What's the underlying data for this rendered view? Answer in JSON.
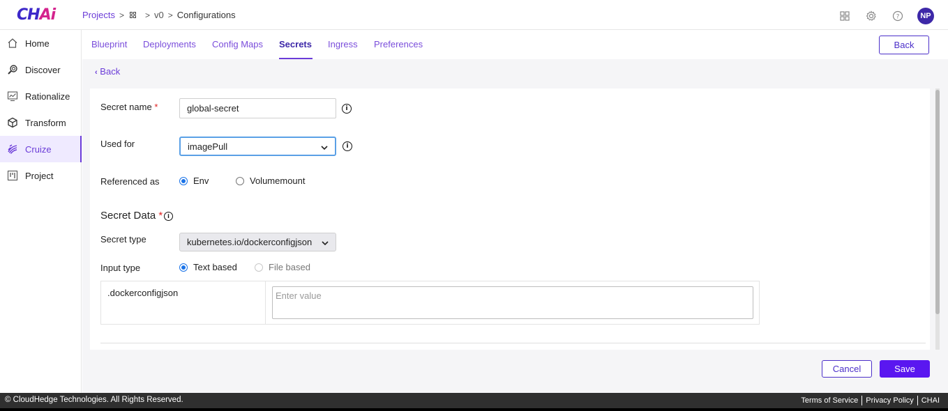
{
  "app": {
    "logo_main": "CH",
    "logo_accent": "Ai"
  },
  "breadcrumb": {
    "projects": "Projects",
    "sep": ">",
    "version": "v0",
    "current": "Configurations"
  },
  "header": {
    "avatar_initials": "NP",
    "icons": [
      "apps-grid-icon",
      "settings-gear-icon",
      "help-icon"
    ]
  },
  "sidebar": {
    "items": [
      {
        "label": "Home",
        "icon": "home-icon"
      },
      {
        "label": "Discover",
        "icon": "discover-icon"
      },
      {
        "label": "Rationalize",
        "icon": "rationalize-icon"
      },
      {
        "label": "Transform",
        "icon": "transform-icon"
      },
      {
        "label": "Cruize",
        "icon": "cruize-icon",
        "active": true
      },
      {
        "label": "Project",
        "icon": "project-icon"
      }
    ]
  },
  "tabs": {
    "items": [
      "Blueprint",
      "Deployments",
      "Config Maps",
      "Secrets",
      "Ingress",
      "Preferences"
    ],
    "active": "Secrets",
    "back_label": "Back"
  },
  "content": {
    "back_link": "Back"
  },
  "form": {
    "secret_name_label": "Secret name",
    "required_mark": "*",
    "secret_name_value": "global-secret",
    "used_for_label": "Used for",
    "used_for_value": "imagePull",
    "referenced_as_label": "Referenced as",
    "ref_option_env": "Env",
    "ref_option_volumemount": "Volumemount",
    "secret_data_title": "Secret Data",
    "secret_type_label": "Secret type",
    "secret_type_value": "kubernetes.io/dockerconfigjson",
    "input_type_label": "Input type",
    "input_option_text": "Text based",
    "input_option_file": "File based",
    "key_name": ".dockerconfigjson",
    "value_placeholder": "Enter value"
  },
  "actions": {
    "cancel": "Cancel",
    "save": "Save"
  },
  "footer": {
    "copyright": "© CloudHedge Technologies. All Rights Reserved.",
    "terms": "Terms of Service",
    "privacy": "Privacy Policy",
    "brand": "CHAI"
  },
  "colors": {
    "accent": "#6b3cd8",
    "primary_button": "#5a17f0",
    "logo": "#3d28c9",
    "logo_accent": "#d4238d"
  }
}
